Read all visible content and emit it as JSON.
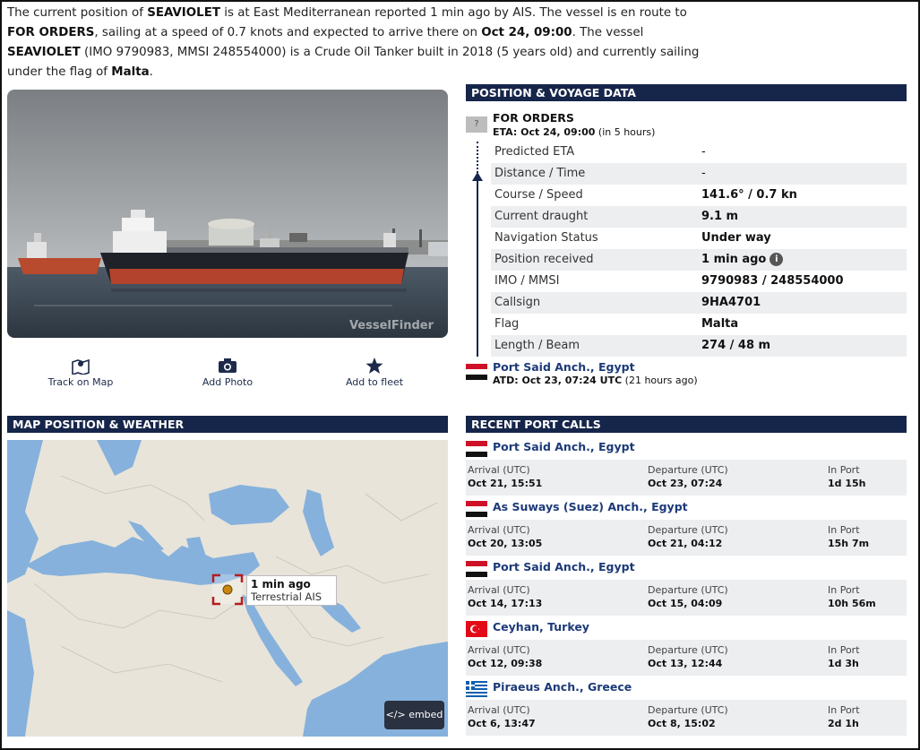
{
  "intro": {
    "p1": "The current position of ",
    "vessel_name": "SEAVIOLET",
    "p2": " is at East Mediterranean reported 1 min ago by AIS. The vessel is en route to ",
    "destination": "FOR ORDERS",
    "p3": ", sailing at a speed of 0.7 knots and expected to arrive there on ",
    "eta": "Oct 24, 09:00",
    "p4": ". The vessel ",
    "vessel_name2": "SEAVIOLET",
    "p5": " (IMO 9790983, MMSI 248554000) is a Crude Oil Tanker built in 2018 (5 years old) and currently sailing under the flag of ",
    "flag": "Malta",
    "p6": "."
  },
  "photo": {
    "watermark": "VesselFinder"
  },
  "actions": {
    "track": "Track on Map",
    "add_photo": "Add Photo",
    "add_fleet": "Add to fleet"
  },
  "voyage": {
    "header": "POSITION & VOYAGE DATA",
    "unknown_mark": "?",
    "destination": "FOR ORDERS",
    "eta_label": "ETA: Oct 24, 09:00",
    "eta_rel": " (in 5 hours)",
    "rows": [
      {
        "k": "Predicted ETA",
        "v": "-"
      },
      {
        "k": "Distance / Time",
        "v": "-"
      },
      {
        "k": "Course / Speed",
        "v": "141.6° / 0.7 kn"
      },
      {
        "k": "Current draught",
        "v": "9.1 m"
      },
      {
        "k": "Navigation Status",
        "v": "Under way"
      },
      {
        "k": "Position received",
        "v": "1 min ago"
      },
      {
        "k": "IMO / MMSI",
        "v": "9790983 / 248554000"
      },
      {
        "k": "Callsign",
        "v": "9HA4701"
      },
      {
        "k": "Flag",
        "v": "Malta"
      },
      {
        "k": "Length / Beam",
        "v": "274 / 48 m"
      }
    ],
    "departure_port": "Port Said Anch., Egypt",
    "atd": "ATD: Oct 23, 07:24 UTC",
    "atd_rel": " (21 hours ago)"
  },
  "map": {
    "header": "MAP POSITION & WEATHER",
    "popup_time": "1 min ago",
    "popup_source": "Terrestrial AIS",
    "embed": "</> embed"
  },
  "port_calls": {
    "header": "RECENT PORT CALLS",
    "arrival_label": "Arrival (UTC)",
    "departure_label": "Departure (UTC)",
    "inport_label": "In Port",
    "items": [
      {
        "port": "Port Said Anch., Egypt",
        "flag": "egypt",
        "arrival": "Oct 21, 15:51",
        "departure": "Oct 23, 07:24",
        "in_port": "1d 15h"
      },
      {
        "port": "As Suways (Suez) Anch., Egypt",
        "flag": "egypt",
        "arrival": "Oct 20, 13:05",
        "departure": "Oct 21, 04:12",
        "in_port": "15h 7m"
      },
      {
        "port": "Port Said Anch., Egypt",
        "flag": "egypt",
        "arrival": "Oct 14, 17:13",
        "departure": "Oct 15, 04:09",
        "in_port": "10h 56m"
      },
      {
        "port": "Ceyhan, Turkey",
        "flag": "turkey",
        "arrival": "Oct 12, 09:38",
        "departure": "Oct 13, 12:44",
        "in_port": "1d 3h"
      },
      {
        "port": "Piraeus Anch., Greece",
        "flag": "greece",
        "arrival": "Oct 6, 13:47",
        "departure": "Oct 8, 15:02",
        "in_port": "2d 1h"
      }
    ]
  },
  "colors": {
    "header_bg": "#16254a",
    "link": "#1c3a78",
    "row_alt": "#eceef0"
  }
}
